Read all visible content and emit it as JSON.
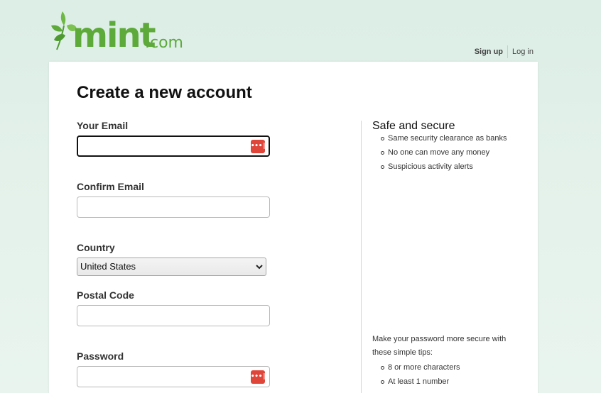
{
  "header": {
    "logo_text": "mint",
    "logo_dotcom": ".com",
    "signup_label": "Sign up",
    "login_label": "Log in"
  },
  "form": {
    "title": "Create a new account",
    "email_label": "Your Email",
    "email_value": "",
    "confirm_email_label": "Confirm Email",
    "confirm_email_value": "",
    "country_label": "Country",
    "country_selected": "United States",
    "postal_label": "Postal Code",
    "postal_value": "",
    "password_label": "Password",
    "password_value": "",
    "password_manager_glyph": "•••|"
  },
  "sidebar": {
    "title": "Safe and secure",
    "items": [
      {
        "label": "Same security clearance as banks"
      },
      {
        "label": "No one can move any money"
      },
      {
        "label": "Suspicious activity alerts"
      }
    ],
    "tips_intro": "Make your password more secure with these simple tips:",
    "tips": [
      {
        "label": "8 or more characters"
      },
      {
        "label": "At least 1 number"
      }
    ]
  },
  "colors": {
    "brand_green": "#5da93a",
    "leaf_green": "#6fb845",
    "password_icon_red": "#e0453a",
    "background": "#dceee6"
  },
  "icons": {
    "logo": "mint-leaf-icon",
    "password_manager": "password-manager-icon",
    "select_chevron": "chevron-down-icon"
  }
}
